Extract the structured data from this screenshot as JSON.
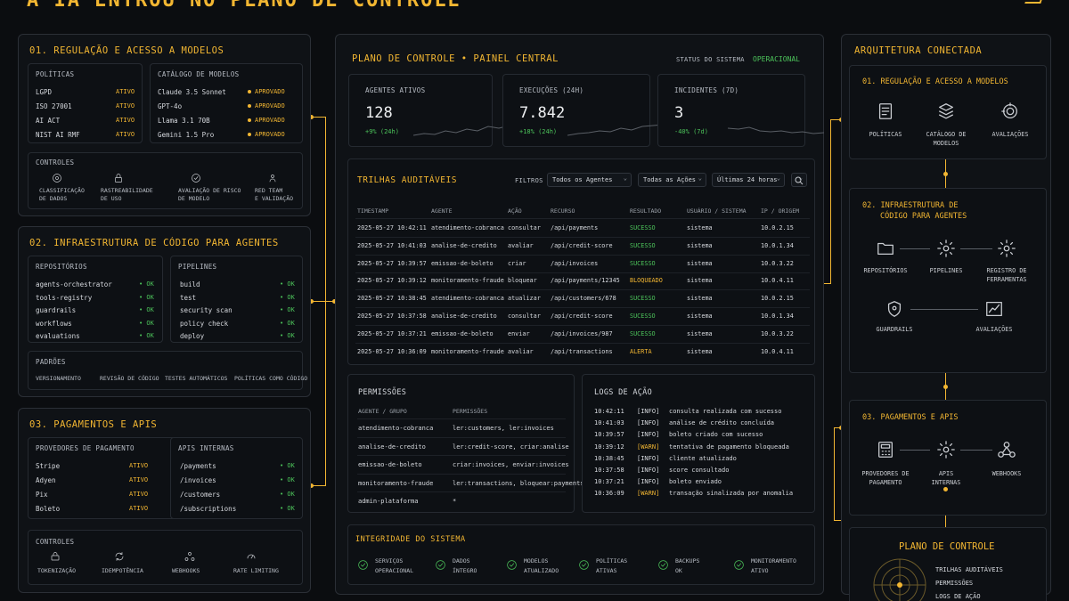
{
  "page": {
    "title": "A IA ENTROU NO PLANO DE CONTROLE"
  },
  "left": {
    "s1": {
      "title": "01. REGULAÇÃO E ACESSO A MODELOS",
      "politicas": {
        "title": "POLÍTICAS",
        "items": [
          {
            "name": "LGPD",
            "status": "ATIVO"
          },
          {
            "name": "ISO 27001",
            "status": "ATIVO"
          },
          {
            "name": "AI ACT",
            "status": "ATIVO"
          },
          {
            "name": "NIST AI RMF",
            "status": "ATIVO"
          }
        ]
      },
      "catalogo": {
        "title": "CATÁLOGO DE MODELOS",
        "items": [
          {
            "name": "Claude 3.5 Sonnet",
            "status": "APROVADO"
          },
          {
            "name": "GPT-4o",
            "status": "APROVADO"
          },
          {
            "name": "Llama 3.1 70B",
            "status": "APROVADO"
          },
          {
            "name": "Gemini 1.5 Pro",
            "status": "APROVADO"
          }
        ]
      },
      "controles": {
        "title": "CONTROLES",
        "items": [
          {
            "l1": "CLASSIFICAÇÃO",
            "l2": "DE DADOS"
          },
          {
            "l1": "RASTREABILIDADE",
            "l2": "DE USO"
          },
          {
            "l1": "AVALIAÇÃO DE RISCO",
            "l2": "DE MODELO"
          },
          {
            "l1": "RED TEAM",
            "l2": "E VALIDAÇÃO"
          }
        ]
      }
    },
    "s2": {
      "title": "02. INFRAESTRUTURA DE CÓDIGO PARA AGENTES",
      "repos": {
        "title": "REPOSITÓRIOS",
        "items": [
          {
            "name": "agents-orchestrator",
            "status": "OK"
          },
          {
            "name": "tools-registry",
            "status": "OK"
          },
          {
            "name": "guardrails",
            "status": "OK"
          },
          {
            "name": "workflows",
            "status": "OK"
          },
          {
            "name": "evaluations",
            "status": "OK"
          }
        ]
      },
      "pipes": {
        "title": "PIPELINES",
        "items": [
          {
            "name": "build",
            "status": "OK"
          },
          {
            "name": "test",
            "status": "OK"
          },
          {
            "name": "security scan",
            "status": "OK"
          },
          {
            "name": "policy check",
            "status": "OK"
          },
          {
            "name": "deploy",
            "status": "OK"
          }
        ]
      },
      "padroes": {
        "title": "PADRÕES",
        "items": [
          "VERSIONAMENTO",
          "REVISÃO DE CÓDIGO",
          "TESTES AUTOMÁTICOS",
          "POLÍTICAS COMO CÓDIGO"
        ]
      }
    },
    "s3": {
      "title": "03. PAGAMENTOS E APIS",
      "prov": {
        "title": "PROVEDORES DE PAGAMENTO",
        "items": [
          {
            "name": "Stripe",
            "status": "ATIVO"
          },
          {
            "name": "Adyen",
            "status": "ATIVO"
          },
          {
            "name": "Pix",
            "status": "ATIVO"
          },
          {
            "name": "Boleto",
            "status": "ATIVO"
          }
        ]
      },
      "apis": {
        "title": "APIS INTERNAS",
        "items": [
          {
            "name": "/payments",
            "status": "OK"
          },
          {
            "name": "/invoices",
            "status": "OK"
          },
          {
            "name": "/customers",
            "status": "OK"
          },
          {
            "name": "/subscriptions",
            "status": "OK"
          }
        ]
      },
      "controles": {
        "title": "CONTROLES",
        "items": [
          "TOKENIZAÇÃO",
          "IDEMPOTÊNCIA",
          "WEBHOOKS",
          "RATE LIMITING"
        ]
      }
    }
  },
  "center": {
    "title": "PLANO DE CONTROLE • PAINEL CENTRAL",
    "status_label": "STATUS DO SISTEMA",
    "status_value": "OPERACIONAL",
    "kpis": [
      {
        "label": "AGENTES ATIVOS",
        "value": "128",
        "delta": "+9% (24h)"
      },
      {
        "label": "EXECUÇÕES (24H)",
        "value": "7.842",
        "delta": "+18% (24h)"
      },
      {
        "label": "INCIDENTES (7D)",
        "value": "3",
        "delta": "-40% (7d)"
      }
    ],
    "trilhas": {
      "title": "TRILHAS AUDITÁVEIS",
      "filter_label": "FILTROS",
      "filters": [
        "Todos os Agentes",
        "Todas as Ações",
        "Últimas 24 horas"
      ],
      "headers": [
        "TIMESTAMP",
        "AGENTE",
        "AÇÃO",
        "RECURSO",
        "RESULTADO",
        "USUÁRIO / SISTEMA",
        "IP / ORIGEM"
      ],
      "rows": [
        [
          "2025-05-27 10:42:11",
          "atendimento-cobranca",
          "consultar",
          "/api/payments",
          "SUCESSO",
          "sistema",
          "10.0.2.15"
        ],
        [
          "2025-05-27 10:41:03",
          "analise-de-credito",
          "avaliar",
          "/api/credit-score",
          "SUCESSO",
          "sistema",
          "10.0.1.34"
        ],
        [
          "2025-05-27 10:39:57",
          "emissao-de-boleto",
          "criar",
          "/api/invoices",
          "SUCESSO",
          "sistema",
          "10.0.3.22"
        ],
        [
          "2025-05-27 10:39:12",
          "monitoramento-fraude",
          "bloquear",
          "/api/payments/12345",
          "BLOQUEADO",
          "sistema",
          "10.0.4.11"
        ],
        [
          "2025-05-27 10:38:45",
          "atendimento-cobranca",
          "atualizar",
          "/api/customers/678",
          "SUCESSO",
          "sistema",
          "10.0.2.15"
        ],
        [
          "2025-05-27 10:37:58",
          "analise-de-credito",
          "consultar",
          "/api/credit-score",
          "SUCESSO",
          "sistema",
          "10.0.1.34"
        ],
        [
          "2025-05-27 10:37:21",
          "emissao-de-boleto",
          "enviar",
          "/api/invoices/987",
          "SUCESSO",
          "sistema",
          "10.0.3.22"
        ],
        [
          "2025-05-27 10:36:09",
          "monitoramento-fraude",
          "avaliar",
          "/api/transactions",
          "ALERTA",
          "sistema",
          "10.0.4.11"
        ]
      ]
    },
    "perm": {
      "title": "PERMISSÕES",
      "headers": [
        "AGENTE / GRUPO",
        "PERMISSÕES"
      ],
      "rows": [
        [
          "atendimento-cobranca",
          "ler:customers, ler:invoices"
        ],
        [
          "analise-de-credito",
          "ler:credit-score, criar:analise"
        ],
        [
          "emissao-de-boleto",
          "criar:invoices, enviar:invoices"
        ],
        [
          "monitoramento-fraude",
          "ler:transactions, bloquear:payments"
        ],
        [
          "admin-plataforma",
          "*"
        ]
      ]
    },
    "logs": {
      "title": "LOGS DE AÇÃO",
      "rows": [
        [
          "10:42:11",
          "[INFO]",
          "consulta realizada com sucesso"
        ],
        [
          "10:41:03",
          "[INFO]",
          "análise de crédito concluída"
        ],
        [
          "10:39:57",
          "[INFO]",
          "boleto criado com sucesso"
        ],
        [
          "10:39:12",
          "[WARN]",
          "tentativa de pagamento bloqueada"
        ],
        [
          "10:38:45",
          "[INFO]",
          "cliente atualizado"
        ],
        [
          "10:37:58",
          "[INFO]",
          "score consultado"
        ],
        [
          "10:37:21",
          "[INFO]",
          "boleto enviado"
        ],
        [
          "10:36:09",
          "[WARN]",
          "transação sinalizada por anomalia"
        ]
      ]
    },
    "integ": {
      "title": "INTEGRIDADE DO SISTEMA",
      "items": [
        {
          "l1": "SERVIÇOS",
          "l2": "OPERACIONAL"
        },
        {
          "l1": "DADOS",
          "l2": "ÍNTEGRO"
        },
        {
          "l1": "MODELOS",
          "l2": "ATUALIZADO"
        },
        {
          "l1": "POLÍTICAS",
          "l2": "ATIVAS"
        },
        {
          "l1": "BACKUPS",
          "l2": "OK"
        },
        {
          "l1": "MONITORAMENTO",
          "l2": "ATIVO"
        }
      ]
    }
  },
  "right": {
    "title": "ARQUITETURA CONECTADA",
    "b1": {
      "title": "01. REGULAÇÃO E ACESSO A MODELOS",
      "items": [
        {
          "l1": "POLÍTICAS",
          "l2": ""
        },
        {
          "l1": "CATÁLOGO DE",
          "l2": "MODELOS"
        },
        {
          "l1": "AVALIAÇÕES",
          "l2": ""
        }
      ]
    },
    "b2": {
      "title1": "02. INFRAESTRUTURA DE",
      "title2": "CÓDIGO PARA AGENTES",
      "items": [
        {
          "l1": "REPOSITÓRIOS",
          "l2": ""
        },
        {
          "l1": "PIPELINES",
          "l2": ""
        },
        {
          "l1": "REGISTRO DE",
          "l2": "FERRAMENTAS"
        },
        {
          "l1": "GUARDRAILS",
          "l2": ""
        },
        {
          "l1": "AVALIAÇÕES",
          "l2": ""
        }
      ]
    },
    "b3": {
      "title": "03. PAGAMENTOS E APIS",
      "items": [
        {
          "l1": "PROVEDORES DE",
          "l2": "PAGAMENTO"
        },
        {
          "l1": "APIS",
          "l2": "INTERNAS"
        },
        {
          "l1": "WEBHOOKS",
          "l2": ""
        }
      ]
    },
    "b4": {
      "title": "PLANO DE CONTROLE",
      "items": [
        "TRILHAS AUDITÁVEIS",
        "PERMISSÕES",
        "LOGS DE AÇÃO"
      ]
    }
  },
  "colors": {
    "accent": "#f2b632",
    "ok": "#4cc35a",
    "bg": "#0b0d10"
  }
}
